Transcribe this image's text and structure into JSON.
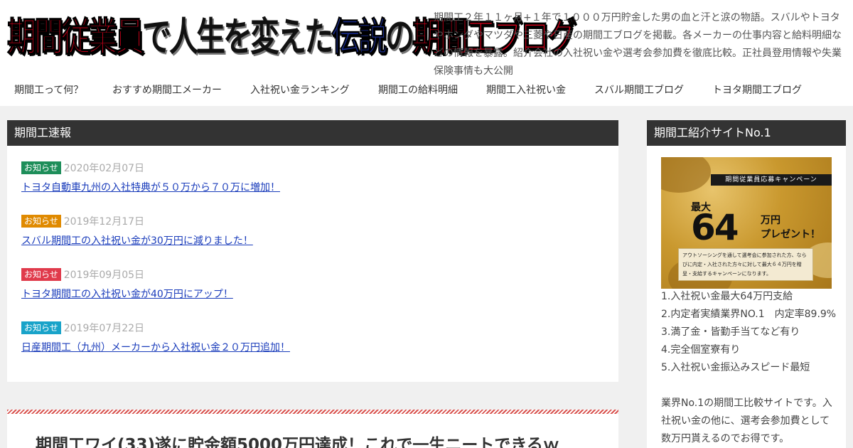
{
  "header": {
    "logo": {
      "part1": "期間従業員",
      "part2": "で人生を変えた",
      "part3": "伝説",
      "part4": "の",
      "part5": "期間工ブログ"
    },
    "description": "期間工２年１１ヶ月+１年で１０００万円貯金した男の血と汗と涙の物語。スバルやトヨタやホンダやマツダや三菱や日産の期間工ブログを掲載。各メーカーの仕事内容と給料明細などの情報を暴露。紹介会社の入社祝い金や選考会参加費を徹底比較。正社員登用情報や失業保険事情も大公開"
  },
  "nav": {
    "items": [
      {
        "label": "期間工って何？"
      },
      {
        "label": "おすすめ期間工メーカー"
      },
      {
        "label": "入社祝い金ランキング"
      },
      {
        "label": "期間工の給料明細"
      },
      {
        "label": "期間工入社祝い金"
      },
      {
        "label": "スバル期間工ブログ"
      },
      {
        "label": "トヨタ期間工ブログ"
      }
    ]
  },
  "news": {
    "title": "期間工速報",
    "items": [
      {
        "badge": "お知らせ",
        "badge_color": "#1e8e5a",
        "date": "2020年02月07日",
        "link": "トヨタ自動車九州の入社特典が５０万から７０万に増加！"
      },
      {
        "badge": "お知らせ",
        "badge_color": "#e08a00",
        "date": "2019年12月17日",
        "link": "スバル期間工の入社祝い金が30万円に減りました！"
      },
      {
        "badge": "お知らせ",
        "badge_color": "#e03a4b",
        "date": "2019年09月05日",
        "link": "トヨタ期間工の入社祝い金が40万円にアップ！"
      },
      {
        "badge": "お知らせ",
        "badge_color": "#19a3c9",
        "date": "2019年07月22日",
        "link": "日産期間工（九州）メーカーから入社祝い金２０万円追加！"
      }
    ]
  },
  "article": {
    "title": "期間工ワイ(33)遂に貯金額5000万円達成！これで一生ニートできるｗ"
  },
  "sidebar": {
    "title": "期間工紹介サイトNo.1",
    "banner": {
      "strip": "期間従業員応募キャンペーン",
      "saidai": "最大",
      "amount": "64",
      "manen": "万円",
      "present": "プレゼント！",
      "note": "アウトソーシングを通して選考会に参加された方、ならびに内定・入社された方々に対して最大６４万円を贈呈・支給するキャンペーンになります。"
    },
    "list": [
      "1.入社祝い金最大64万円支給",
      "2.内定者実績業界NO.1　内定率89.9%",
      "3.満了金・皆勤手当てなど有り",
      "4.完全個室寮有り",
      "5.入社祝い金振込みスピード最短"
    ],
    "paragraph": "業界No.1の期間工比較サイトです。入社祝い金の他に、選考会参加費として数万円貰えるのでお得です。"
  }
}
